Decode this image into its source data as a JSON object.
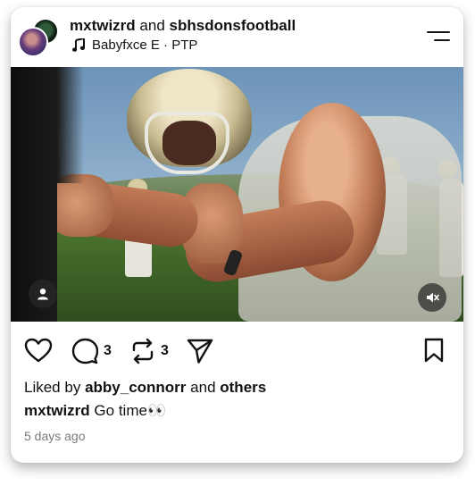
{
  "post": {
    "author": "mxtwizrd",
    "conjunction": "and",
    "collaborator": "sbhsdonsfootball",
    "music": "Babyfxce E · PTP"
  },
  "actions": {
    "reply_count": "3",
    "repost_count": "3"
  },
  "likes": {
    "prefix": "Liked by",
    "user": "abby_connorr",
    "conjunction": "and",
    "others": "others"
  },
  "caption": {
    "author": "mxtwizrd",
    "text": "Go time👀"
  },
  "timestamp": "5 days ago",
  "icons": {
    "music": "music-note-icon",
    "menu": "menu-icon",
    "tag": "person-tag-icon",
    "mute": "speaker-muted-icon",
    "like": "heart-icon",
    "reply": "comment-icon",
    "repost": "repost-icon",
    "share": "send-icon",
    "save": "bookmark-icon"
  }
}
